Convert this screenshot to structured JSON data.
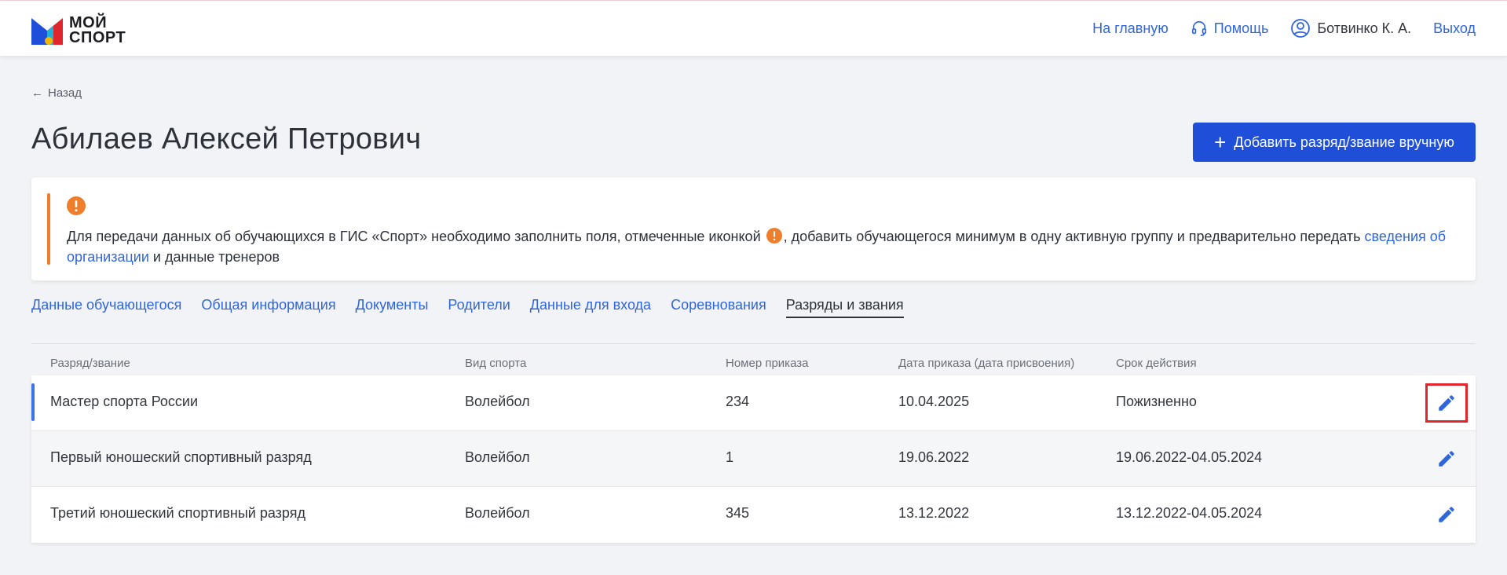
{
  "header": {
    "logo_line1": "МОЙ",
    "logo_line2": "СПОРТ",
    "home_label": "На главную",
    "help_label": "Помощь",
    "user_name": "Ботвинко К. А.",
    "logout_label": "Выход"
  },
  "back_label": "Назад",
  "page_title": "Абилаев Алексей Петрович",
  "add_button_label": "Добавить разряд/звание вручную",
  "notice": {
    "text_before_icon": "Для передачи данных об обучающихся в ГИС «Спорт» необходимо заполнить поля, отмеченные иконкой ",
    "text_after_icon": ", добавить обучающегося минимум в одну активную группу и предварительно передать ",
    "link_text": "сведения об организации",
    "text_end": " и данные тренеров"
  },
  "tabs": [
    {
      "label": "Данные обучающегося"
    },
    {
      "label": "Общая информация"
    },
    {
      "label": "Документы"
    },
    {
      "label": "Родители"
    },
    {
      "label": "Данные для входа"
    },
    {
      "label": "Соревнования"
    },
    {
      "label": "Разряды и звания",
      "active": true
    }
  ],
  "table": {
    "headers": [
      "Разряд/звание",
      "Вид спорта",
      "Номер приказа",
      "Дата приказа (дата присвоения)",
      "Срок действия"
    ],
    "rows": [
      [
        "Мастер спорта России",
        "Волейбол",
        "234",
        "10.04.2025",
        "Пожизненно"
      ],
      [
        "Первый юношеский спортивный разряд",
        "Волейбол",
        "1",
        "19.06.2022",
        "19.06.2022-04.05.2024"
      ],
      [
        "Третий юношеский спортивный разряд",
        "Волейбол",
        "345",
        "13.12.2022",
        "13.12.2022-04.05.2024"
      ]
    ]
  },
  "icons": {
    "edit": "pencil-icon",
    "warning": "exclamation-icon",
    "help": "headset-icon",
    "user": "user-circle-icon",
    "back": "arrow-left-icon",
    "add": "plus-icon"
  },
  "colors": {
    "accent": "#2f66dc",
    "primary_button": "#1f4fd8",
    "warning": "#ee7d2c",
    "highlight": "#e0262d"
  }
}
